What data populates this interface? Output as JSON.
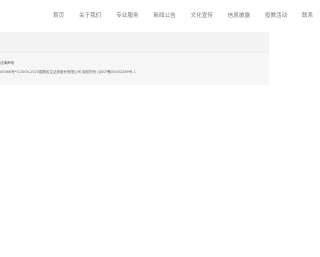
{
  "nav": {
    "items": [
      {
        "label": "首页"
      },
      {
        "label": "关于我们"
      },
      {
        "label": "专业服务"
      },
      {
        "label": "新闻公告"
      },
      {
        "label": "文化宣传"
      },
      {
        "label": "信息披露"
      },
      {
        "label": "投教活动"
      },
      {
        "label": "联系"
      }
    ]
  },
  "footer": {
    "link_label": "法律声明",
    "copyright": "00086号*©2005-2020国联民生证券股份有限公司 版权所有 |京ICP备05002289号-1"
  }
}
